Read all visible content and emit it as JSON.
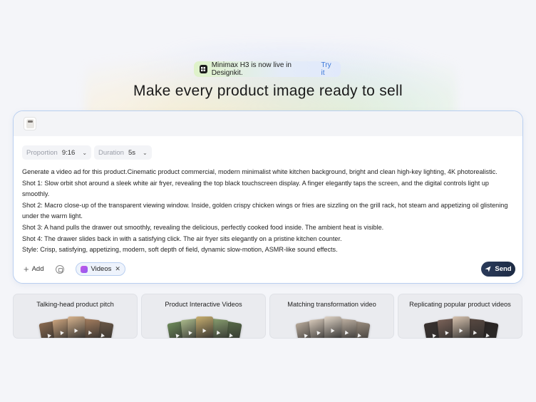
{
  "announcement": {
    "text": "Minimax H3 is now live in Designkit.",
    "cta": "Try it"
  },
  "headline": "Make every product image ready to sell",
  "controls": {
    "proportion": {
      "label": "Proportion",
      "value": "9:16"
    },
    "duration": {
      "label": "Duration",
      "value": "5s"
    }
  },
  "prompt_lines": [
    "Generate a video ad for this product.Cinematic product commercial, modern minimalist white kitchen background, bright and clean high-key lighting, 4K photorealistic.",
    "Shot 1: Slow orbit shot around a sleek white air fryer, revealing the top black touchscreen display. A finger elegantly taps the screen, and the digital controls light up smoothly.",
    "Shot 2: Macro close-up of the transparent viewing window. Inside, golden crispy chicken wings or fries are sizzling on the grill rack, hot steam and appetizing oil glistening under the warm light.",
    "Shot 3: A hand pulls the drawer out smoothly, revealing the delicious, perfectly cooked food inside. The ambient heat is visible.",
    "Shot 4: The drawer slides back in with a satisfying click. The air fryer sits elegantly on a pristine kitchen counter.",
    "Style: Crisp, satisfying, appetizing, modern, soft depth of field, dynamic slow-motion, ASMR-like sound effects."
  ],
  "toolbar": {
    "add_label": "Add",
    "chip_label": "Videos",
    "send_label": "Send"
  },
  "examples": [
    {
      "title": "Talking-head product pitch",
      "colors": [
        "#8a6a50",
        "#c9a27c",
        "#d8b48e",
        "#a88060",
        "#6d5a48"
      ]
    },
    {
      "title": "Product Interactive Videos",
      "colors": [
        "#6d8a5a",
        "#a9b88a",
        "#c9b070",
        "#8aa070",
        "#5a6d4a"
      ]
    },
    {
      "title": "Matching transformation video",
      "colors": [
        "#b7a99a",
        "#d5c7b8",
        "#e0d4c6",
        "#c2b4a5",
        "#a09283"
      ]
    },
    {
      "title": "Replicating popular product videos",
      "colors": [
        "#3a3230",
        "#7a6258",
        "#d9c4b0",
        "#5a4a42",
        "#2a2422"
      ]
    }
  ],
  "icons": {
    "announcement_logo": "designkit-logo-icon",
    "add": "plus-icon",
    "style": "cube-icon",
    "chip": "video-icon",
    "send": "send-icon"
  }
}
